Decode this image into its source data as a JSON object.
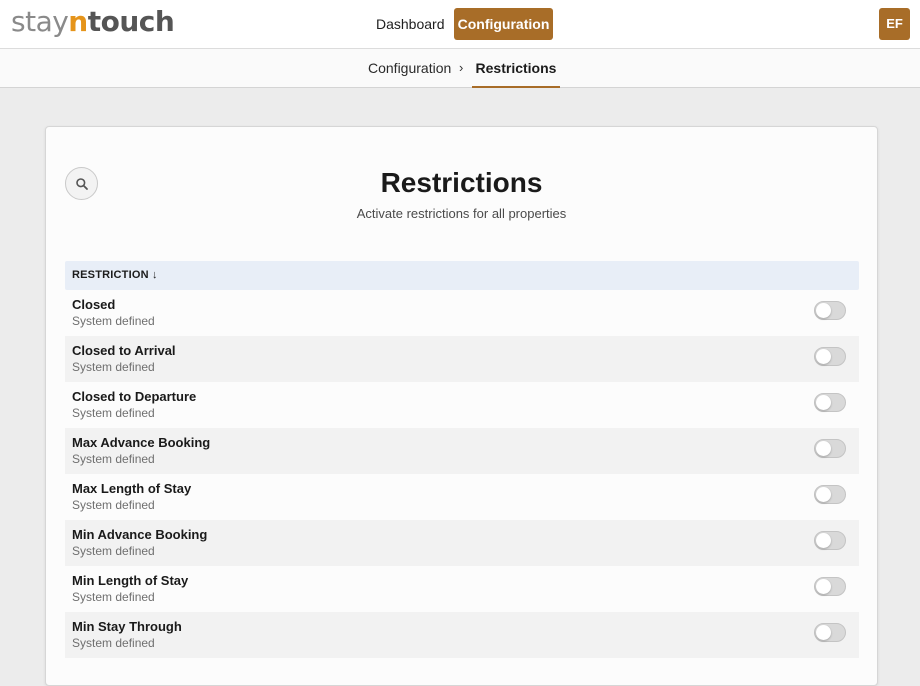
{
  "header": {
    "logo": {
      "part1": "stay",
      "part2": "n",
      "part3": "touch"
    },
    "nav": {
      "dashboard": "Dashboard",
      "configuration": "Configuration"
    },
    "avatar_initials": "EF"
  },
  "breadcrumb": {
    "parent": "Configuration",
    "separator": "›",
    "current": "Restrictions"
  },
  "page": {
    "title": "Restrictions",
    "subtitle": "Activate restrictions for all properties"
  },
  "table": {
    "column_header": "RESTRICTION ↓",
    "rows": [
      {
        "name": "Closed",
        "sub": "System defined",
        "enabled": false
      },
      {
        "name": "Closed to Arrival",
        "sub": "System defined",
        "enabled": false
      },
      {
        "name": "Closed to Departure",
        "sub": "System defined",
        "enabled": false
      },
      {
        "name": "Max Advance Booking",
        "sub": "System defined",
        "enabled": false
      },
      {
        "name": "Max Length of Stay",
        "sub": "System defined",
        "enabled": false
      },
      {
        "name": "Min Advance Booking",
        "sub": "System defined",
        "enabled": false
      },
      {
        "name": "Min Length of Stay",
        "sub": "System defined",
        "enabled": false
      },
      {
        "name": "Min Stay Through",
        "sub": "System defined",
        "enabled": false
      }
    ]
  },
  "colors": {
    "accent": "#a86d28",
    "logo_accent": "#e5941a",
    "header_row": "#e8eef7"
  },
  "icons": {
    "search": "search-icon"
  }
}
